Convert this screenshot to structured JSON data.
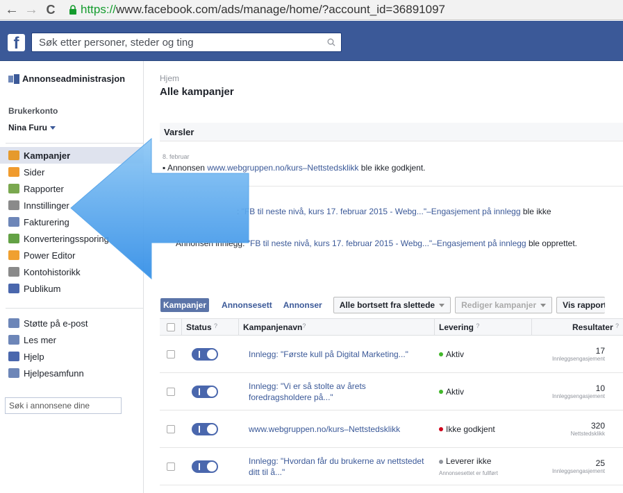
{
  "browser": {
    "url_secure": "https://",
    "url_rest": "www.facebook.com/ads/manage/home/?account_id=36891097",
    "back": "←",
    "forward": "→",
    "reload": "C"
  },
  "header": {
    "logo": "f",
    "search_placeholder": "Søk etter personer, steder og ting"
  },
  "sidebar": {
    "title": "Annonseadministrasjon",
    "account_label": "Brukerkonto",
    "account_name": "Nina Furu",
    "items": [
      {
        "label": "Kampanjer",
        "icon": "megaphone-icon",
        "color": "#e69a2c"
      },
      {
        "label": "Sider",
        "icon": "flag-icon",
        "color": "#f09b2e"
      },
      {
        "label": "Rapporter",
        "icon": "chart-icon",
        "color": "#7aa84f"
      },
      {
        "label": "Innstillinger",
        "icon": "settings-icon",
        "color": "#8a8a8a"
      },
      {
        "label": "Fakturering",
        "icon": "billing-icon",
        "color": "#6d86b8"
      },
      {
        "label": "Konverteringssporing",
        "icon": "tracking-icon",
        "color": "#63a145"
      },
      {
        "label": "Power Editor",
        "icon": "power-editor-icon",
        "color": "#f0a030"
      },
      {
        "label": "Kontohistorikk",
        "icon": "history-icon",
        "color": "#8a8a8a"
      },
      {
        "label": "Publikum",
        "icon": "audience-icon",
        "color": "#4a67ad"
      }
    ],
    "support": [
      {
        "label": "Støtte på e-post",
        "icon": "mail-icon",
        "color": "#6d86b8"
      },
      {
        "label": "Les mer",
        "icon": "megaphone-small-icon",
        "color": "#6d86b8"
      },
      {
        "label": "Hjelp",
        "icon": "help-icon",
        "color": "#4a67ad"
      },
      {
        "label": "Hjelpesamfunn",
        "icon": "community-icon",
        "color": "#6d86b8"
      }
    ],
    "search_placeholder": "Søk i annonsene dine"
  },
  "main": {
    "breadcrumb": "Hjem",
    "title": "Alle kampanjer",
    "alerts_title": "Varsler",
    "alert_date": "8. februar",
    "alert1_pre": "Annonsen ",
    "alert1_link": "www.webgruppen.no/kurs–Nettstedsklikk",
    "alert1_post": " ble ikke godkjent.",
    "alert2_pre": ": ",
    "alert2_link": "\"FB til neste nivå, kurs 17. februar 2015 - Webg...\"–Engasjement på innlegg",
    "alert2_post": " ble ikke",
    "alert3_pre": "Annonsen innlegg: ",
    "alert3_link": "\"FB til neste nivå, kurs 17. februar 2015 - Webg...\"–Engasjement på innlegg",
    "alert3_post": " ble opprettet."
  },
  "toolbar": {
    "tab_campaigns": "Kampanjer",
    "tab_adsets": "Annonsesett",
    "tab_ads": "Annonser",
    "filter": "Alle bortsett fra slettede",
    "edit": "Rediger kampanjer",
    "report": "Vis rapport"
  },
  "table": {
    "headers": {
      "status": "Status",
      "name": "Kampanjenavn",
      "delivery": "Levering",
      "results": "Resultater",
      "q": "?"
    },
    "rows": [
      {
        "name": "Innlegg: \"Første kull på Digital Marketing...\"",
        "delivery": "Aktiv",
        "delivery_color": "#42b72a",
        "delivery_sub": "",
        "result": "17",
        "result_sub": "Innleggsengasjement"
      },
      {
        "name": "Innlegg: \"Vi er så stolte av årets foredragsholdere på...\"",
        "delivery": "Aktiv",
        "delivery_color": "#42b72a",
        "delivery_sub": "",
        "result": "10",
        "result_sub": "Innleggsengasjement"
      },
      {
        "name": "www.webgruppen.no/kurs–Nettstedsklikk",
        "delivery": "Ikke godkjent",
        "delivery_color": "#d0021b",
        "delivery_sub": "",
        "result": "320",
        "result_sub": "Nettstedsklikk"
      },
      {
        "name": "Innlegg: \"Hvordan får du brukerne av nettstedet ditt til å...\"",
        "delivery": "Leverer ikke",
        "delivery_color": "#90949c",
        "delivery_sub": "Annonsesettet er fullført",
        "result": "25",
        "result_sub": "Innleggsengasjement"
      }
    ]
  }
}
